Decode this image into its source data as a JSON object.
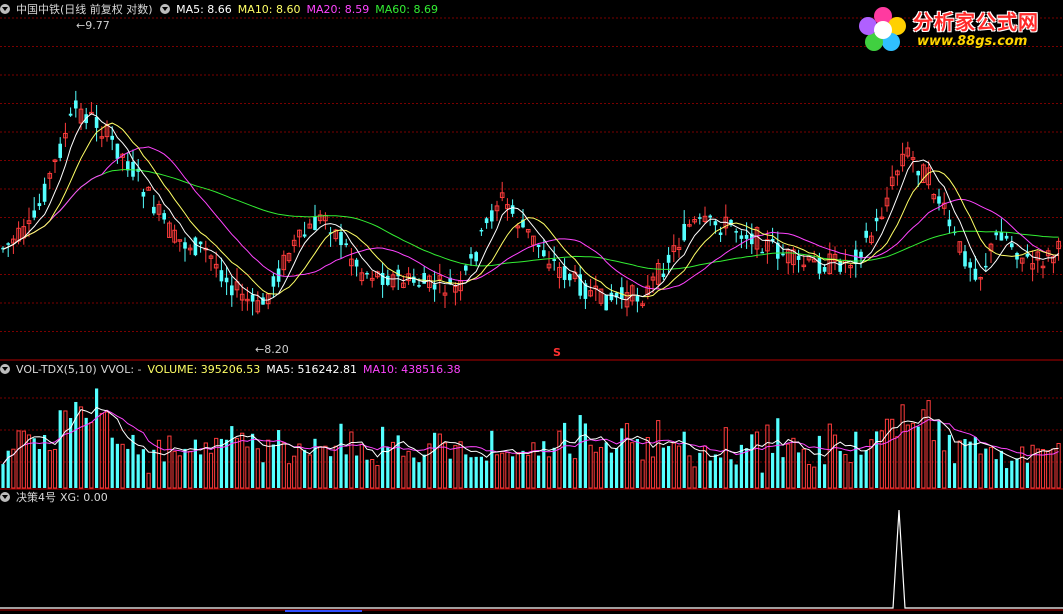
{
  "main_panel": {
    "stock_title": "中国中铁(日线 前复权 对数)",
    "ma_labels": [
      {
        "text": "MA5: 8.66",
        "color": "#ffffff"
      },
      {
        "text": "MA10: 8.60",
        "color": "#ffff66"
      },
      {
        "text": "MA20: 8.59",
        "color": "#ff44ff"
      },
      {
        "text": "MA60: 8.69",
        "color": "#33ee33"
      }
    ],
    "high_label": "9.77",
    "low_label": "8.20",
    "signal_marker": "S"
  },
  "volume_panel": {
    "indicator_name": "VOL-TDX(5,10)",
    "vvol_text": "VVOL: -",
    "volume_text": "VOLUME: 395206.53",
    "ma5_text": "MA5: 516242.81",
    "ma10_text": "MA10: 438516.38",
    "colors": {
      "volume": "#ffff66",
      "ma5": "#ffffff",
      "ma10": "#ff44ff"
    }
  },
  "signal_panel": {
    "indicator_name": "决策4号",
    "xg_text": "XG: 0.00"
  },
  "logo": {
    "title": "分析家公式网",
    "url": "www.88gs.com"
  },
  "colors": {
    "up": "#ff3c3c",
    "down": "#54ffff",
    "grid": "#7a0000",
    "ma5": "#ffffff",
    "ma10": "#ffff66",
    "ma20": "#ff44ff",
    "ma60": "#33ee33",
    "signal": "#ffffff"
  }
}
